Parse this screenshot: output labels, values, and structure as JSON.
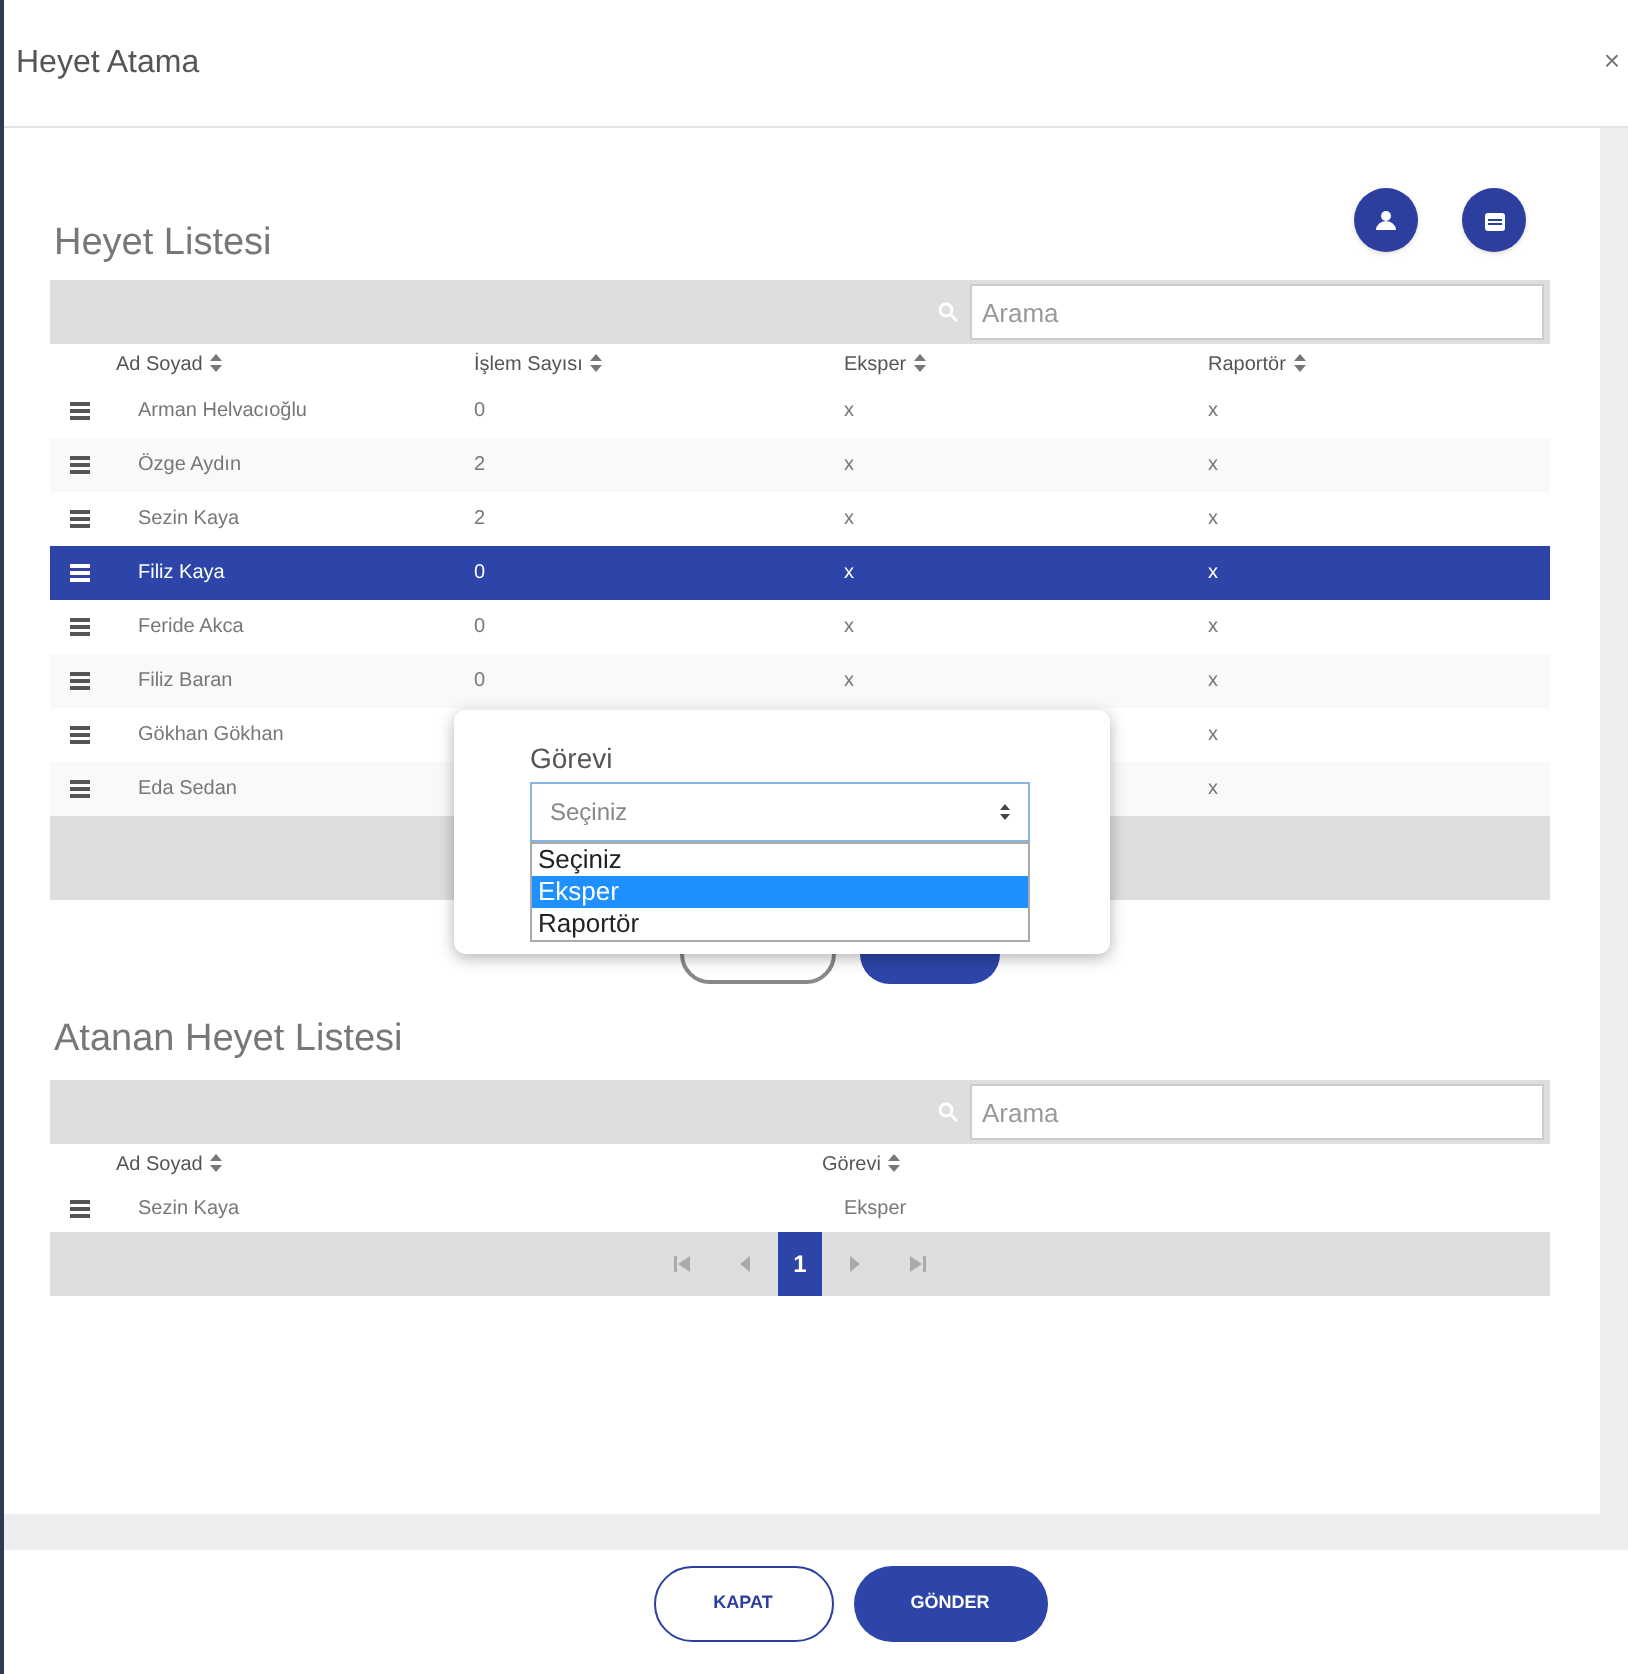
{
  "window": {
    "title": "Heyet Atama",
    "close": "×"
  },
  "heyet_listesi": {
    "title": "Heyet Listesi",
    "search": {
      "placeholder": "Arama"
    },
    "columns": [
      "Ad Soyad",
      "İşlem Sayısı",
      "Eksper",
      "Raportör"
    ],
    "rows": [
      {
        "name": "Arman Helvacıoğlu",
        "count": "0",
        "eksper": "x",
        "raportor": "x",
        "selected": false
      },
      {
        "name": "Özge Aydın",
        "count": "2",
        "eksper": "x",
        "raportor": "x",
        "selected": false
      },
      {
        "name": "Sezin Kaya",
        "count": "2",
        "eksper": "x",
        "raportor": "x",
        "selected": false
      },
      {
        "name": "Filiz Kaya",
        "count": "0",
        "eksper": "x",
        "raportor": "x",
        "selected": true
      },
      {
        "name": "Feride Akca",
        "count": "0",
        "eksper": "x",
        "raportor": "x",
        "selected": false
      },
      {
        "name": "Filiz Baran",
        "count": "0",
        "eksper": "x",
        "raportor": "x",
        "selected": false
      },
      {
        "name": "Gökhan Gökhan",
        "raportor": "x",
        "selected": false
      },
      {
        "name": "Eda Sedan",
        "raportor": "x",
        "selected": false
      }
    ]
  },
  "popup": {
    "label": "Görevi",
    "select": {
      "value": "Seçiniz"
    },
    "options": [
      {
        "label": "Seçiniz",
        "selected": false
      },
      {
        "label": "Eksper",
        "selected": true
      },
      {
        "label": "Raportör",
        "selected": false
      }
    ]
  },
  "atanan_heyet_listesi": {
    "title": "Atanan Heyet Listesi",
    "search": {
      "placeholder": "Arama"
    },
    "columns": [
      "Ad Soyad",
      "Görevi"
    ],
    "rows": [
      {
        "name": "Sezin Kaya",
        "gorevi": "Eksper"
      }
    ],
    "pages": [
      {
        "label": "1",
        "selected": true
      }
    ]
  },
  "footer": {
    "buttons": [
      {
        "label": "KAPAT",
        "kind": "outline"
      },
      {
        "label": "GÖNDER",
        "kind": "primary"
      }
    ]
  }
}
